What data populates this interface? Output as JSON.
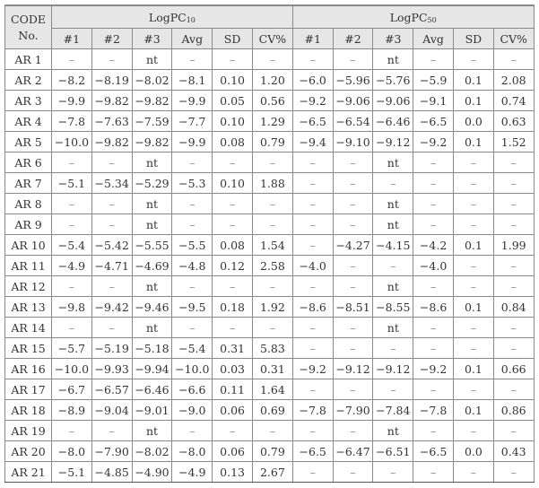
{
  "table": {
    "code_header_line1": "CODE",
    "code_header_line2": "No.",
    "groups": [
      {
        "label_base": "LogPC",
        "label_sub": "10"
      },
      {
        "label_base": "LogPC",
        "label_sub": "50"
      }
    ],
    "subheaders": [
      "#1",
      "#2",
      "#3",
      "Avg",
      "SD",
      "CV%"
    ],
    "rows": [
      {
        "code": "AR 1",
        "pc10": [
          "–",
          "–",
          "nt",
          "–",
          "–",
          "–"
        ],
        "pc50": [
          "–",
          "–",
          "nt",
          "–",
          "–",
          "–"
        ]
      },
      {
        "code": "AR 2",
        "pc10": [
          "−8.2",
          "−8.19",
          "−8.02",
          "−8.1",
          "0.10",
          "1.20"
        ],
        "pc50": [
          "−6.0",
          "−5.96",
          "−5.76",
          "−5.9",
          "0.1",
          "2.08"
        ]
      },
      {
        "code": "AR 3",
        "pc10": [
          "−9.9",
          "−9.82",
          "−9.82",
          "−9.9",
          "0.05",
          "0.56"
        ],
        "pc50": [
          "−9.2",
          "−9.06",
          "−9.06",
          "−9.1",
          "0.1",
          "0.74"
        ]
      },
      {
        "code": "AR 4",
        "pc10": [
          "−7.8",
          "−7.63",
          "−7.59",
          "−7.7",
          "0.10",
          "1.29"
        ],
        "pc50": [
          "−6.5",
          "−6.54",
          "−6.46",
          "−6.5",
          "0.0",
          "0.63"
        ]
      },
      {
        "code": "AR 5",
        "pc10": [
          "−10.0",
          "−9.82",
          "−9.82",
          "−9.9",
          "0.08",
          "0.79"
        ],
        "pc50": [
          "−9.4",
          "−9.10",
          "−9.12",
          "−9.2",
          "0.1",
          "1.52"
        ]
      },
      {
        "code": "AR 6",
        "pc10": [
          "–",
          "–",
          "nt",
          "–",
          "–",
          "–"
        ],
        "pc50": [
          "–",
          "–",
          "nt",
          "–",
          "–",
          "–"
        ]
      },
      {
        "code": "AR 7",
        "pc10": [
          "−5.1",
          "−5.34",
          "−5.29",
          "−5.3",
          "0.10",
          "1.88"
        ],
        "pc50": [
          "–",
          "–",
          "–",
          "–",
          "–",
          "–"
        ]
      },
      {
        "code": "AR 8",
        "pc10": [
          "–",
          "–",
          "nt",
          "–",
          "–",
          "–"
        ],
        "pc50": [
          "–",
          "–",
          "nt",
          "–",
          "–",
          "–"
        ]
      },
      {
        "code": "AR 9",
        "pc10": [
          "–",
          "–",
          "nt",
          "–",
          "–",
          "–"
        ],
        "pc50": [
          "–",
          "–",
          "nt",
          "–",
          "–",
          "–"
        ]
      },
      {
        "code": "AR 10",
        "pc10": [
          "−5.4",
          "−5.42",
          "−5.55",
          "−5.5",
          "0.08",
          "1.54"
        ],
        "pc50": [
          "–",
          "−4.27",
          "−4.15",
          "−4.2",
          "0.1",
          "1.99"
        ]
      },
      {
        "code": "AR 11",
        "pc10": [
          "−4.9",
          "−4.71",
          "−4.69",
          "−4.8",
          "0.12",
          "2.58"
        ],
        "pc50": [
          "−4.0",
          "–",
          "–",
          "−4.0",
          "–",
          "–"
        ]
      },
      {
        "code": "AR 12",
        "pc10": [
          "–",
          "–",
          "nt",
          "–",
          "–",
          "–"
        ],
        "pc50": [
          "–",
          "–",
          "nt",
          "–",
          "–",
          "–"
        ]
      },
      {
        "code": "AR 13",
        "pc10": [
          "−9.8",
          "−9.42",
          "−9.46",
          "−9.5",
          "0.18",
          "1.92"
        ],
        "pc50": [
          "−8.6",
          "−8.51",
          "−8.55",
          "−8.6",
          "0.1",
          "0.84"
        ]
      },
      {
        "code": "AR 14",
        "pc10": [
          "–",
          "–",
          "nt",
          "–",
          "–",
          "–"
        ],
        "pc50": [
          "–",
          "–",
          "nt",
          "–",
          "–",
          "–"
        ]
      },
      {
        "code": "AR 15",
        "pc10": [
          "−5.7",
          "−5.19",
          "−5.18",
          "−5.4",
          "0.31",
          "5.83"
        ],
        "pc50": [
          "–",
          "–",
          "–",
          "–",
          "–",
          "–"
        ]
      },
      {
        "code": "AR 16",
        "pc10": [
          "−10.0",
          "−9.93",
          "−9.94",
          "−10.0",
          "0.03",
          "0.31"
        ],
        "pc50": [
          "−9.2",
          "−9.12",
          "−9.12",
          "−9.2",
          "0.1",
          "0.66"
        ]
      },
      {
        "code": "AR 17",
        "pc10": [
          "−6.7",
          "−6.57",
          "−6.46",
          "−6.6",
          "0.11",
          "1.64"
        ],
        "pc50": [
          "–",
          "–",
          "–",
          "–",
          "–",
          "–"
        ]
      },
      {
        "code": "AR 18",
        "pc10": [
          "−8.9",
          "−9.04",
          "−9.01",
          "−9.0",
          "0.06",
          "0.69"
        ],
        "pc50": [
          "−7.8",
          "−7.90",
          "−7.84",
          "−7.8",
          "0.1",
          "0.86"
        ]
      },
      {
        "code": "AR 19",
        "pc10": [
          "–",
          "–",
          "nt",
          "–",
          "–",
          "–"
        ],
        "pc50": [
          "–",
          "–",
          "nt",
          "–",
          "–",
          "–"
        ]
      },
      {
        "code": "AR 20",
        "pc10": [
          "−8.0",
          "−7.90",
          "−8.02",
          "−8.0",
          "0.06",
          "0.79"
        ],
        "pc50": [
          "−6.5",
          "−6.47",
          "−6.51",
          "−6.5",
          "0.0",
          "0.43"
        ]
      },
      {
        "code": "AR 21",
        "pc10": [
          "−5.1",
          "−4.85",
          "−4.90",
          "−4.9",
          "0.13",
          "2.67"
        ],
        "pc50": [
          "–",
          "–",
          "–",
          "–",
          "–",
          "–"
        ]
      }
    ]
  }
}
